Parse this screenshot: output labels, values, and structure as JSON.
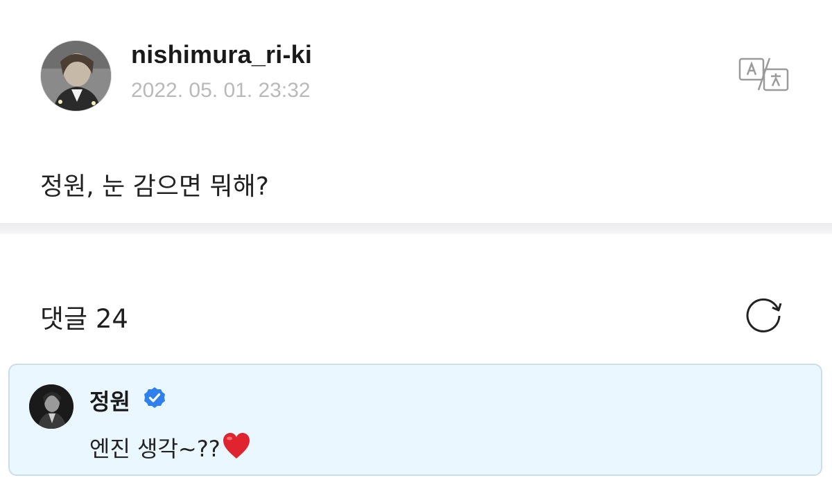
{
  "post": {
    "username": "nishimura_ri-ki",
    "timestamp": "2022. 05. 01. 23:32",
    "body": "정원, 눈 감으면 뭐해?",
    "translate_icon": "translate-icon",
    "avatar_icon": "profile-avatar"
  },
  "comments": {
    "header": "댓글 24",
    "refresh_icon": "refresh-icon",
    "items": [
      {
        "author": "정원",
        "verified": true,
        "text": "엔진 생각~??",
        "emoji": "heart-icon"
      }
    ]
  },
  "colors": {
    "timestamp": "#b9b9b9",
    "comment_bg": "#eaf7ff",
    "comment_border": "#c9ddea",
    "verified": "#2f80ed",
    "heart": "#e0242f"
  }
}
